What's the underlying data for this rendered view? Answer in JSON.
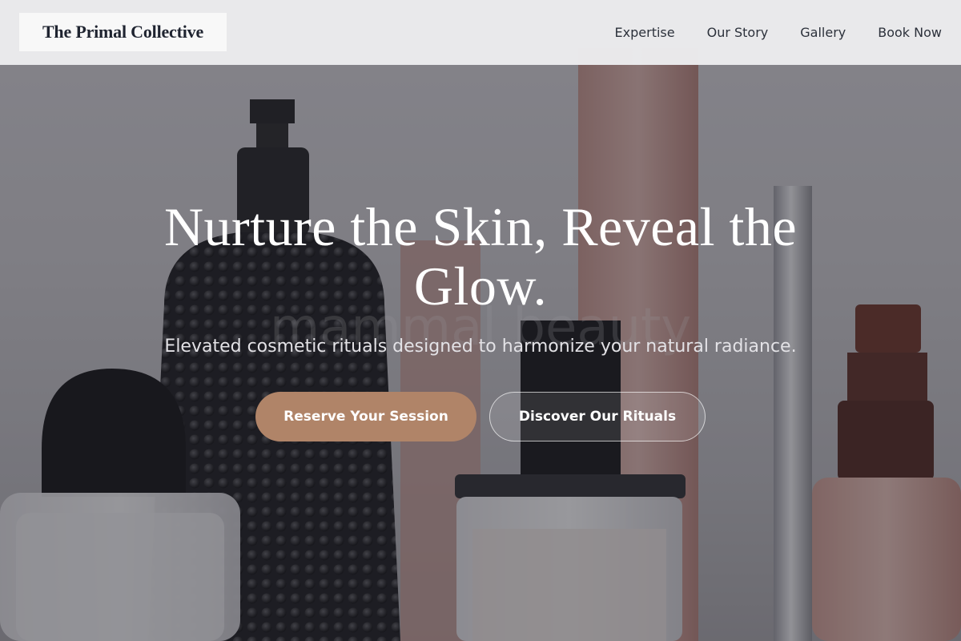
{
  "header": {
    "brand": "The Primal Collective",
    "nav": [
      {
        "label": "Expertise"
      },
      {
        "label": "Our Story"
      },
      {
        "label": "Gallery"
      },
      {
        "label": "Book Now"
      }
    ]
  },
  "hero": {
    "headline": "Nurture the Skin, Reveal the Glow.",
    "subheadline": "Elevated cosmetic rituals designed to harmonize your natural radiance.",
    "primary_cta": "Reserve Your Session",
    "secondary_cta": "Discover Our Rituals",
    "background_watermark": "mammal beauty"
  },
  "colors": {
    "accent": "#b08468",
    "header_bg": "#ececee",
    "brand_text": "#1f2430",
    "hero_text": "#ffffff"
  }
}
